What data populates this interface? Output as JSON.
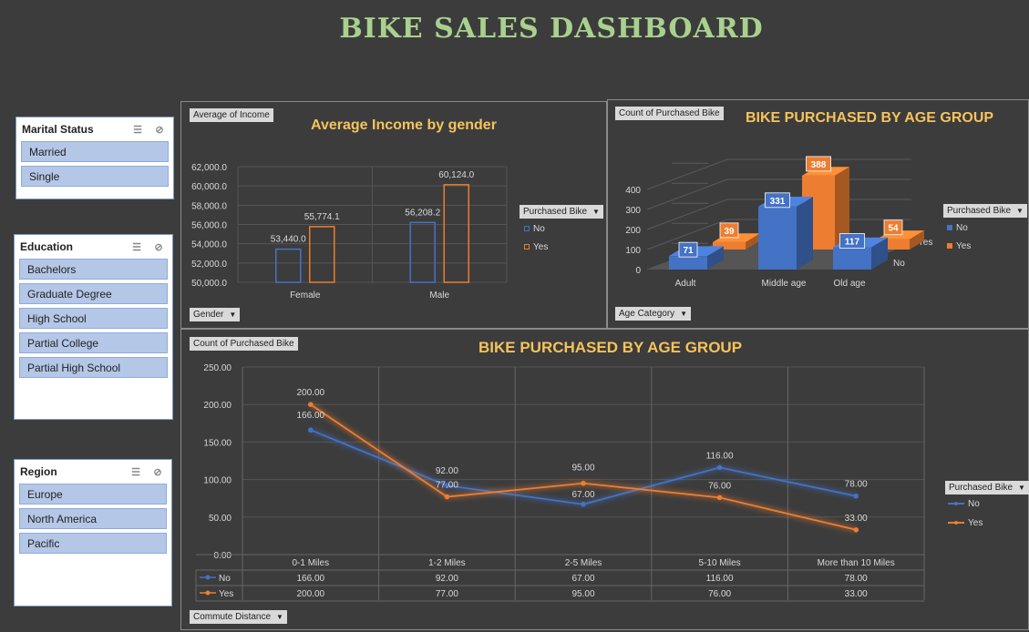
{
  "title": "BIKE SALES DASHBOARD",
  "slicers": {
    "marital": {
      "title": "Marital Status",
      "items": [
        "Married",
        "Single"
      ]
    },
    "education": {
      "title": "Education",
      "items": [
        "Bachelors",
        "Graduate Degree",
        "High School",
        "Partial College",
        "Partial High School"
      ]
    },
    "region": {
      "title": "Region",
      "items": [
        "Europe",
        "North America",
        "Pacific"
      ]
    }
  },
  "colors": {
    "no": "#4472c4",
    "yes": "#ed7d31",
    "title": "#f5c35c",
    "header": "#a9d18e"
  },
  "income_chart": {
    "field_tag": "Average of Income",
    "axis_button": "Gender",
    "legend_button": "Purchased Bike",
    "legend_items": [
      "No",
      "Yes"
    ]
  },
  "age_chart": {
    "field_tag": "Count of Purchased Bike",
    "axis_button": "Age Category",
    "legend_button": "Purchased Bike",
    "legend_items": [
      "No",
      "Yes"
    ],
    "depth_labels": [
      "Yes",
      "No"
    ]
  },
  "commute_chart": {
    "field_tag": "Count of Purchased Bike",
    "axis_button": "Commute Distance",
    "legend_button": "Purchased Bike",
    "legend_items": [
      "No",
      "Yes"
    ],
    "table_rows": [
      {
        "name": "No",
        "values": [
          "166.00",
          "92.00",
          "67.00",
          "116.00",
          "78.00"
        ]
      },
      {
        "name": "Yes",
        "values": [
          "200.00",
          "77.00",
          "95.00",
          "76.00",
          "33.00"
        ]
      }
    ]
  },
  "chart_data": [
    {
      "type": "bar",
      "title": "Average Income by gender",
      "categories": [
        "Female",
        "Male"
      ],
      "series": [
        {
          "name": "No",
          "values": [
            53440.0,
            56208.2
          ],
          "labels": [
            "53,440.0",
            "56,208.2"
          ]
        },
        {
          "name": "Yes",
          "values": [
            55774.1,
            60124.0
          ],
          "labels": [
            "55,774.1",
            "60,124.0"
          ]
        }
      ],
      "ylim": [
        50000,
        62000
      ],
      "yticks": [
        "50,000.0",
        "52,000.0",
        "54,000.0",
        "56,000.0",
        "58,000.0",
        "60,000.0",
        "62,000.0"
      ],
      "grid": true,
      "legend": "right"
    },
    {
      "type": "bar",
      "title": "BIKE PURCHASED BY AGE GROUP",
      "categories": [
        "Adult",
        "Middle age",
        "Old age"
      ],
      "series": [
        {
          "name": "No",
          "values": [
            71,
            331,
            117
          ]
        },
        {
          "name": "Yes",
          "values": [
            39,
            388,
            54
          ]
        }
      ],
      "ylim": [
        0,
        400
      ],
      "yticks": [
        "0",
        "100",
        "200",
        "300",
        "400"
      ],
      "grid": true,
      "legend": "right"
    },
    {
      "type": "line",
      "title": "BIKE PURCHASED BY AGE GROUP",
      "categories": [
        "0-1 Miles",
        "1-2 Miles",
        "2-5 Miles",
        "5-10 Miles",
        "More than 10 Miles"
      ],
      "series": [
        {
          "name": "No",
          "values": [
            166,
            92,
            67,
            116,
            78
          ],
          "labels": [
            "166.00",
            "92.00",
            "67.00",
            "116.00",
            "78.00"
          ]
        },
        {
          "name": "Yes",
          "values": [
            200,
            77,
            95,
            76,
            33
          ],
          "labels": [
            "200.00",
            "77.00",
            "95.00",
            "76.00",
            "33.00"
          ]
        }
      ],
      "ylim": [
        0,
        250
      ],
      "yticks": [
        "0.00",
        "50.00",
        "100.00",
        "150.00",
        "200.00",
        "250.00"
      ],
      "grid": true,
      "legend": "right"
    }
  ]
}
